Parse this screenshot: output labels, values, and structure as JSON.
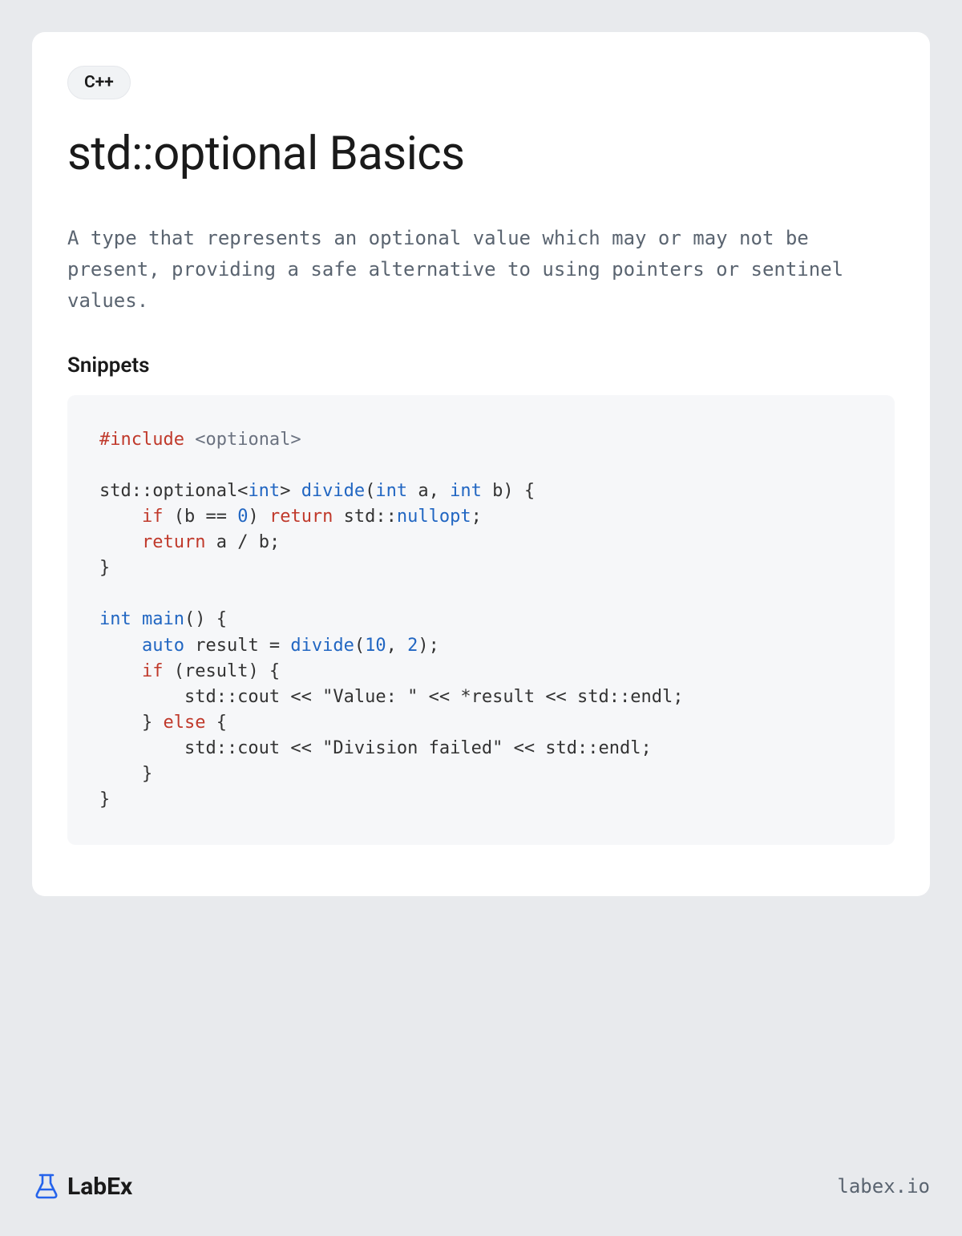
{
  "tag": "C++",
  "title": "std::optional Basics",
  "description": "A type that represents an optional value which may or may not be present, providing a safe alternative to using pointers or sentinel values.",
  "snippets_heading": "Snippets",
  "code": {
    "tokens": [
      {
        "t": "#include",
        "c": "keyword"
      },
      {
        "t": " "
      },
      {
        "t": "<optional>",
        "c": "header"
      },
      {
        "t": "\n\nstd::optional<"
      },
      {
        "t": "int",
        "c": "type"
      },
      {
        "t": "> "
      },
      {
        "t": "divide",
        "c": "func"
      },
      {
        "t": "("
      },
      {
        "t": "int",
        "c": "type"
      },
      {
        "t": " a, "
      },
      {
        "t": "int",
        "c": "type"
      },
      {
        "t": " b) {\n    "
      },
      {
        "t": "if",
        "c": "keyword"
      },
      {
        "t": " (b == "
      },
      {
        "t": "0",
        "c": "number"
      },
      {
        "t": ") "
      },
      {
        "t": "return",
        "c": "keyword"
      },
      {
        "t": " std::"
      },
      {
        "t": "nullopt",
        "c": "type"
      },
      {
        "t": ";\n    "
      },
      {
        "t": "return",
        "c": "keyword"
      },
      {
        "t": " a / b;\n}\n\n"
      },
      {
        "t": "int",
        "c": "type"
      },
      {
        "t": " "
      },
      {
        "t": "main",
        "c": "func"
      },
      {
        "t": "() {\n    "
      },
      {
        "t": "auto",
        "c": "type"
      },
      {
        "t": " result = "
      },
      {
        "t": "divide",
        "c": "func"
      },
      {
        "t": "("
      },
      {
        "t": "10",
        "c": "number"
      },
      {
        "t": ", "
      },
      {
        "t": "2",
        "c": "number"
      },
      {
        "t": ");\n    "
      },
      {
        "t": "if",
        "c": "keyword"
      },
      {
        "t": " (result) {\n        std::cout << "
      },
      {
        "t": "\"Value: \"",
        "c": "string"
      },
      {
        "t": " << *result << std::endl;\n    } "
      },
      {
        "t": "else",
        "c": "keyword"
      },
      {
        "t": " {\n        std::cout << "
      },
      {
        "t": "\"Division failed\"",
        "c": "string"
      },
      {
        "t": " << std::endl;\n    }\n}"
      }
    ]
  },
  "footer": {
    "brand": "LabEx",
    "url": "labex.io"
  }
}
